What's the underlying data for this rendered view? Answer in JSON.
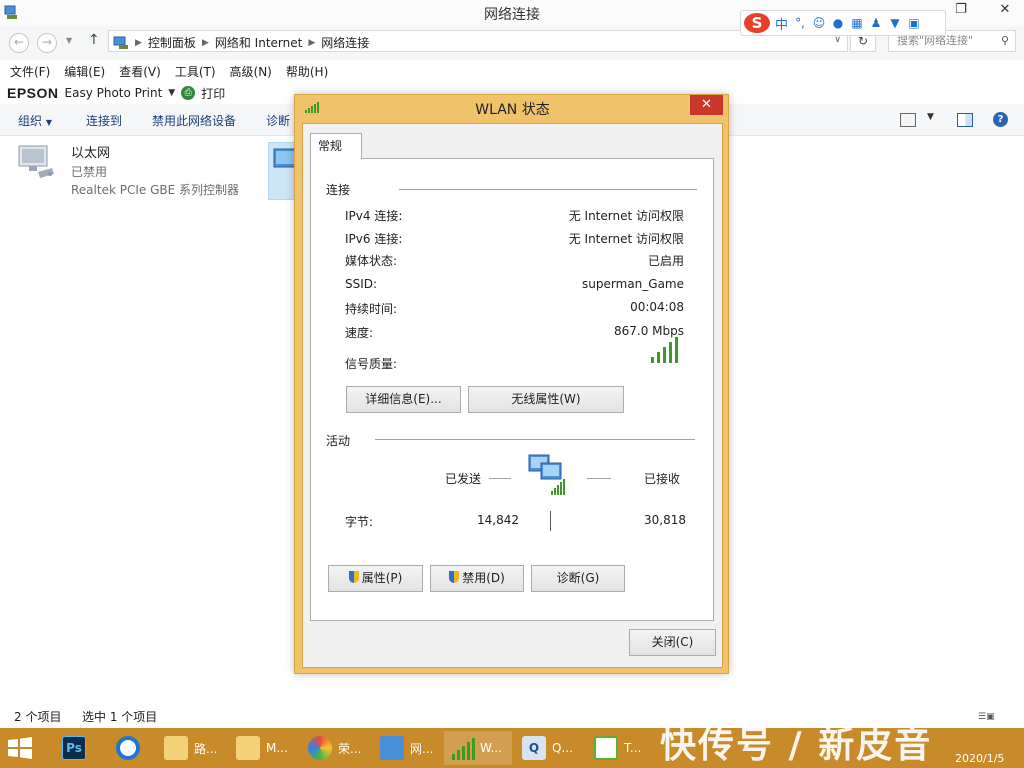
{
  "window": {
    "title": "网络连接",
    "controls": {
      "minimize": "—",
      "restore": "❐",
      "close": "✕"
    }
  },
  "ime": {
    "label": "中"
  },
  "address": {
    "breadcrumbs": [
      "控制面板",
      "网络和 Internet",
      "网络连接"
    ],
    "search_placeholder": "搜索\"网络连接\""
  },
  "menubar": [
    "文件(F)",
    "编辑(E)",
    "查看(V)",
    "工具(T)",
    "高级(N)",
    "帮助(H)"
  ],
  "epson": {
    "brand": "EPSON",
    "app": "Easy Photo Print",
    "print": "打印"
  },
  "commandbar": {
    "organize": "组织",
    "connect_to": "连接到",
    "disable": "禁用此网络设备",
    "diagnose": "诊断"
  },
  "items": [
    {
      "name": "以太网",
      "status": "已禁用",
      "device": "Realtek PCIe GBE 系列控制器"
    }
  ],
  "statusbar": {
    "count": "2 个项目",
    "selected": "选中 1 个项目"
  },
  "dialog": {
    "title": "WLAN 状态",
    "tab": "常规",
    "connection": {
      "header": "连接",
      "rows": [
        {
          "label": "IPv4 连接:",
          "value": "无 Internet 访问权限"
        },
        {
          "label": "IPv6 连接:",
          "value": "无 Internet 访问权限"
        },
        {
          "label": "媒体状态:",
          "value": "已启用"
        },
        {
          "label": "SSID:",
          "value": "superman_Game"
        },
        {
          "label": "持续时间:",
          "value": "00:04:08"
        },
        {
          "label": "速度:",
          "value": "867.0 Mbps"
        }
      ],
      "signal_label": "信号质量:",
      "signal_bars": 5
    },
    "buttons": {
      "details": "详细信息(E)...",
      "wireless_props": "无线属性(W)"
    },
    "activity": {
      "header": "活动",
      "sent_label": "已发送",
      "received_label": "已接收",
      "bytes_label": "字节:",
      "bytes_sent": "14,842",
      "bytes_received": "30,818"
    },
    "actions": {
      "properties": "属性(P)",
      "disable": "禁用(D)",
      "diagnose": "诊断(G)",
      "close": "关闭(C)"
    }
  },
  "taskbar": {
    "items": [
      {
        "icon": "explorer-folder-icon",
        "label": "路..."
      },
      {
        "icon": "folder-icon",
        "label": "M..."
      },
      {
        "icon": "photo-app-icon",
        "label": "荣..."
      },
      {
        "icon": "network-connections-icon",
        "label": "网..."
      },
      {
        "icon": "wlan-status-icon",
        "label": "W..."
      },
      {
        "icon": "q-app-icon",
        "label": "Q..."
      },
      {
        "icon": "wifi-app-icon",
        "label": "T..."
      }
    ],
    "clock_date": "2020/1/5"
  },
  "watermark": "快传号 / 新皮音",
  "colors": {
    "taskbar": "#c98a2a",
    "dialog_frame": "#f0c36b",
    "close_red": "#c9362a",
    "signal_green": "#3e9a27"
  }
}
